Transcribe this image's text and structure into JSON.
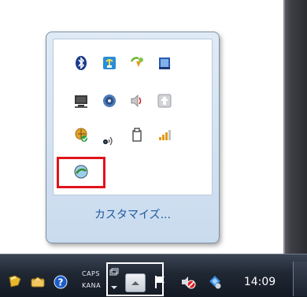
{
  "popup": {
    "customize_label": "カスタマイズ...",
    "icons": [
      [
        "bluetooth-icon",
        "network-adapter-icon",
        "clipboard-arrow-icon",
        "book-icon"
      ],
      [
        "monitor-icon",
        "disc-icon",
        "speaker-icon",
        "upload-arrow-icon"
      ],
      [
        "globe-check-icon",
        "wireless-signal-icon",
        "usb-device-icon",
        "signal-bars-icon"
      ],
      [
        "sync-globe-icon"
      ]
    ]
  },
  "taskbar": {
    "caps_label": "CAPS",
    "kana_label": "KANA",
    "clock": "14:09"
  },
  "colors": {
    "highlight": "#e0141c",
    "link": "#1e5aa0"
  }
}
